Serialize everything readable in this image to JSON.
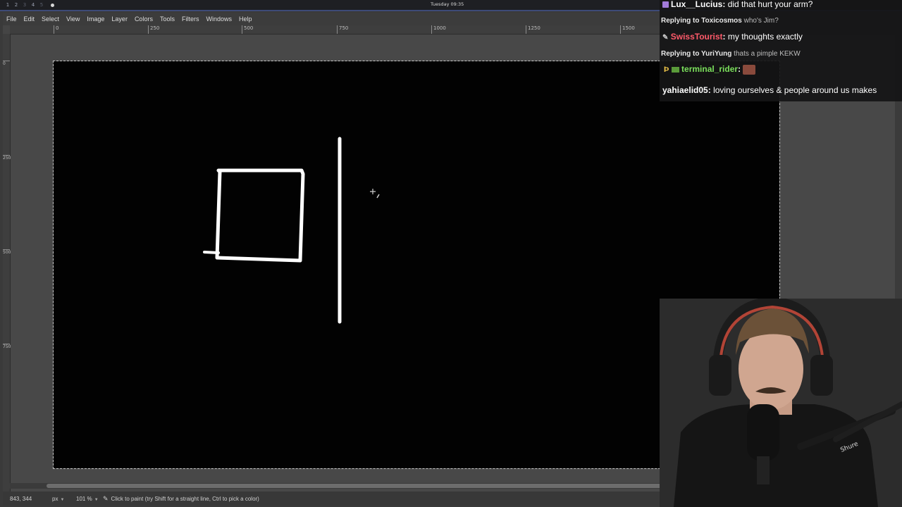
{
  "system_bar": {
    "workspaces": [
      "1",
      "2",
      "3",
      "4",
      "5"
    ],
    "clock": "Tuesday 09:35"
  },
  "gimp": {
    "menu": [
      "File",
      "Edit",
      "Select",
      "View",
      "Image",
      "Layer",
      "Colors",
      "Tools",
      "Filters",
      "Windows",
      "Help"
    ],
    "ruler_top_labels": [
      "0",
      "250",
      "500",
      "750",
      "1000",
      "1250",
      "1500"
    ],
    "ruler_left_labels": [
      "0",
      "250",
      "500",
      "750"
    ],
    "status": {
      "coords": "843, 344",
      "unit": "px",
      "zoom": "101 %",
      "message": "Click to paint (try Shift for a straight line, Ctrl to pick a color)"
    }
  },
  "chat": {
    "messages": [
      {
        "user": "Lux__Lucius",
        "text": "did that hurt your arm?"
      },
      {
        "reply_to": "Replying to Toxicosmos",
        "reply_text": "who's Jim?"
      },
      {
        "user": "SwissTourist",
        "text": "my thoughts exactly"
      },
      {
        "reply_to": "Replying to YuriYung",
        "reply_text": "thats a pimple KEKW"
      },
      {
        "user": "terminal_rider",
        "text": ""
      },
      {
        "user": "yahiaelid05",
        "text": "loving ourselves & people around us makes"
      }
    ]
  },
  "webcam": {
    "mic_brand": "Shure"
  },
  "colors": {
    "accent_border": "#3d4a78",
    "canvas_bg": "#020202",
    "stroke": "#ffffff",
    "chat_red": "#ff5a6a",
    "chat_green": "#7be05c"
  }
}
